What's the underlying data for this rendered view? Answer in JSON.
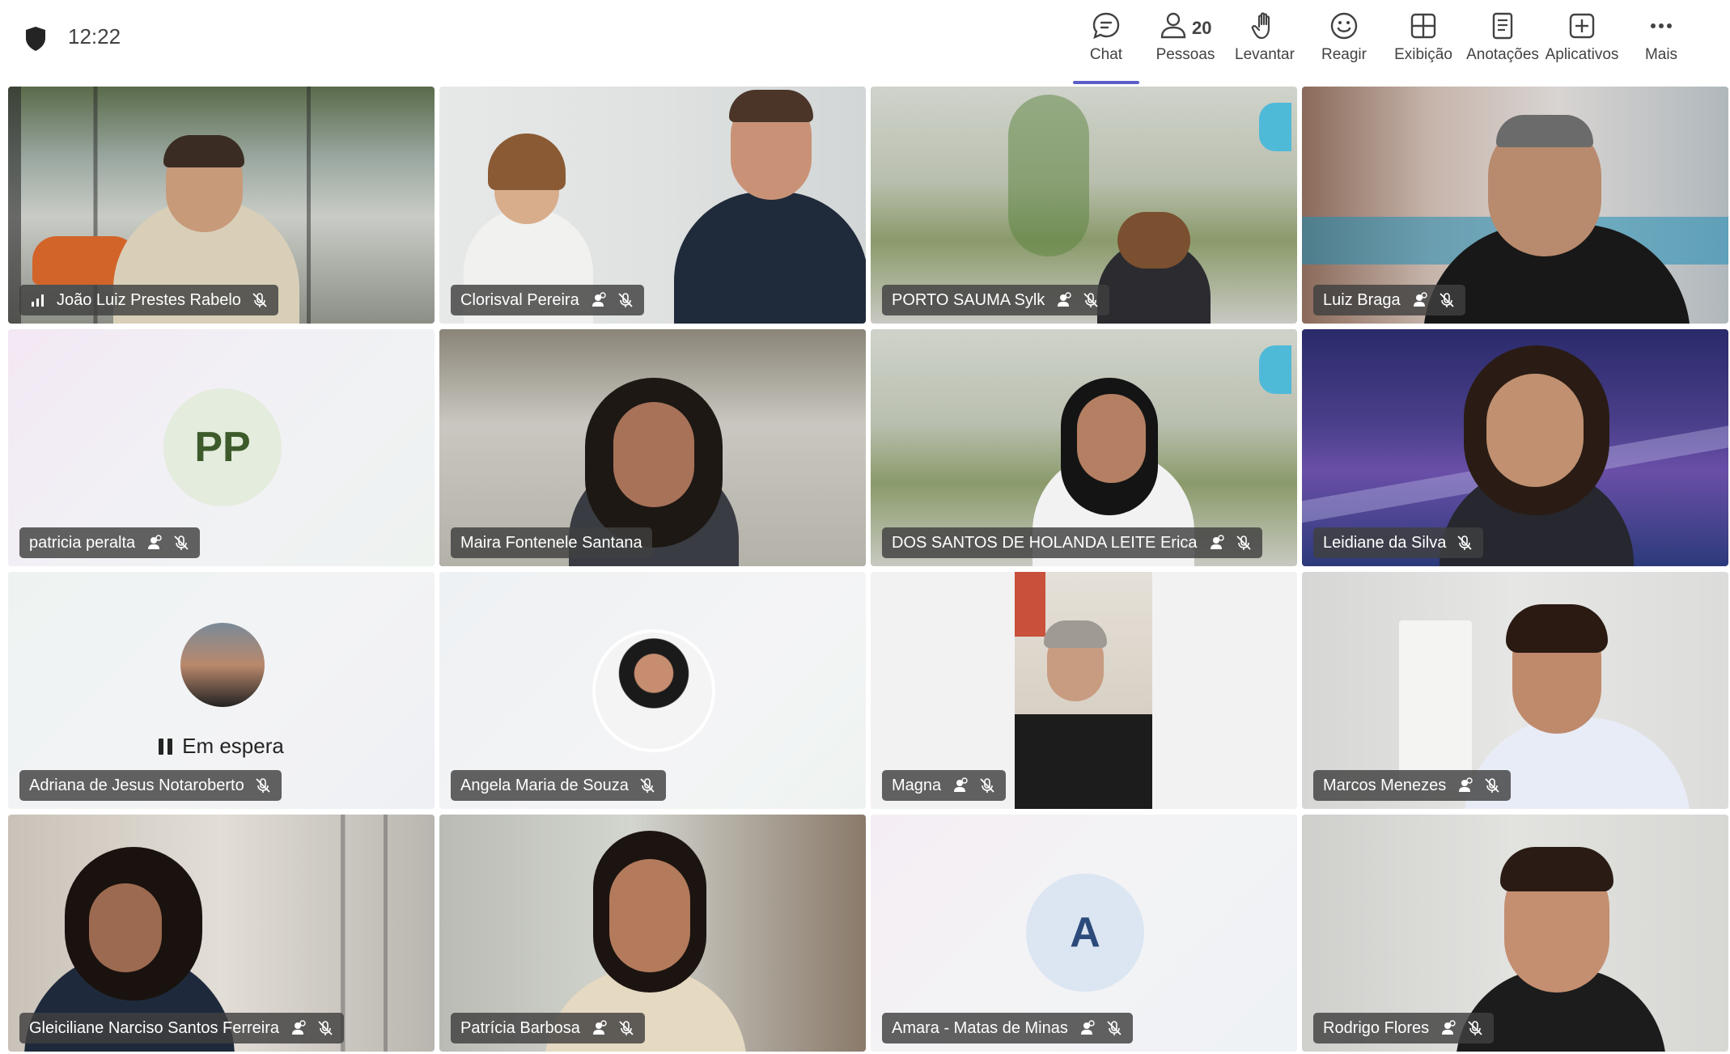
{
  "header": {
    "time": "12:22",
    "toolbar": [
      {
        "label": "Chat",
        "icon": "chat-icon",
        "active": true
      },
      {
        "label": "Pessoas",
        "icon": "people-icon",
        "count": "20"
      },
      {
        "label": "Levantar",
        "icon": "raise-hand-icon"
      },
      {
        "label": "Reagir",
        "icon": "react-icon"
      },
      {
        "label": "Exibição",
        "icon": "view-icon"
      },
      {
        "label": "Anotações",
        "icon": "notes-icon"
      },
      {
        "label": "Aplicativos",
        "icon": "apps-icon"
      },
      {
        "label": "Mais",
        "icon": "more-icon"
      }
    ]
  },
  "participants": [
    {
      "name": "João Luiz Prestes Rabelo",
      "signal": true,
      "muted": true
    },
    {
      "name": "Clorisval Pereira",
      "external": true,
      "muted": true
    },
    {
      "name": "PORTO SAUMA Sylk",
      "external": true,
      "muted": true
    },
    {
      "name": "Luiz Braga",
      "external": true,
      "muted": true
    },
    {
      "name": "patricia peralta",
      "initials": "PP",
      "external": true,
      "muted": true
    },
    {
      "name": "Maira Fontenele Santana",
      "speaking": true
    },
    {
      "name": "DOS SANTOS DE HOLANDA LEITE Erica",
      "external": true,
      "muted": true
    },
    {
      "name": "Leidiane da Silva",
      "muted": true
    },
    {
      "name": "Adriana de Jesus Notaroberto",
      "status": "Em espera",
      "muted": true
    },
    {
      "name": "Angela Maria de Souza",
      "muted": true
    },
    {
      "name": "Magna",
      "external": true,
      "muted": true
    },
    {
      "name": "Marcos Menezes",
      "external": true,
      "muted": true
    },
    {
      "name": "Gleiciliane Narciso Santos Ferreira",
      "external": true,
      "muted": true
    },
    {
      "name": "Patrícia Barbosa",
      "external": true,
      "muted": true
    },
    {
      "name": "Amara - Matas de Minas",
      "initials": "A",
      "external": true,
      "muted": true
    },
    {
      "name": "Rodrigo Flores",
      "external": true,
      "muted": true
    }
  ],
  "colors": {
    "accent": "#5b5fc7",
    "name_bar": "#404040"
  }
}
